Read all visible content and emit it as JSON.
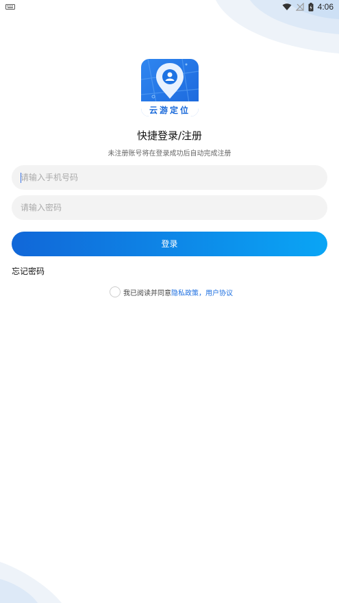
{
  "status_bar": {
    "time": "4:06"
  },
  "app": {
    "logo_text": "云游定位"
  },
  "header": {
    "title": "快捷登录/注册",
    "subtitle": "未注册账号将在登录成功后自动完成注册"
  },
  "form": {
    "phone_placeholder": "请输入手机号码",
    "password_placeholder": "请输入密码",
    "login_label": "登录",
    "forgot_label": "忘记密码"
  },
  "agreement": {
    "prefix": "我已阅读并同意",
    "privacy_label": "隐私政策",
    "separator": "，",
    "user_label": "用户协议",
    "checked": false
  },
  "colors": {
    "accent": "#1167d8",
    "accent_end": "#0aa5f5",
    "link": "#1d6fe0"
  }
}
